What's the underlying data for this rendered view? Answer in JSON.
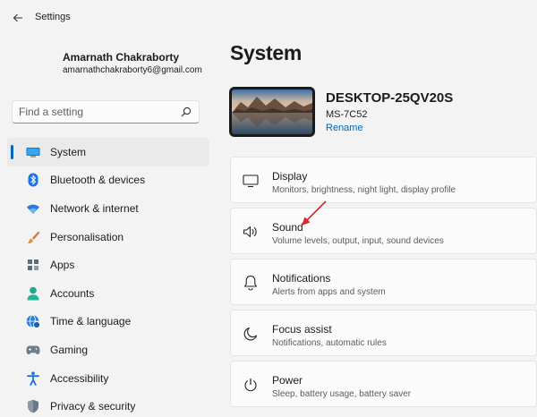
{
  "window": {
    "title": "Settings"
  },
  "profile": {
    "name": "Amarnath Chakraborty",
    "email": "amarnathchakraborty6@gmail.com"
  },
  "search": {
    "placeholder": "Find a setting"
  },
  "nav": {
    "items": [
      {
        "label": "System",
        "icon": "monitor-icon",
        "selected": true
      },
      {
        "label": "Bluetooth & devices",
        "icon": "bluetooth-icon"
      },
      {
        "label": "Network & internet",
        "icon": "wifi-icon"
      },
      {
        "label": "Personalisation",
        "icon": "brush-icon"
      },
      {
        "label": "Apps",
        "icon": "apps-icon"
      },
      {
        "label": "Accounts",
        "icon": "person-icon"
      },
      {
        "label": "Time & language",
        "icon": "globe-clock-icon"
      },
      {
        "label": "Gaming",
        "icon": "gamepad-icon"
      },
      {
        "label": "Accessibility",
        "icon": "accessibility-icon"
      },
      {
        "label": "Privacy & security",
        "icon": "shield-icon"
      }
    ]
  },
  "main": {
    "title": "System",
    "device": {
      "name": "DESKTOP-25QV20S",
      "model": "MS-7C52",
      "rename_label": "Rename"
    },
    "cards": [
      {
        "title": "Display",
        "subtitle": "Monitors, brightness, night light, display profile",
        "icon": "display-icon"
      },
      {
        "title": "Sound",
        "subtitle": "Volume levels, output, input, sound devices",
        "icon": "speaker-icon"
      },
      {
        "title": "Notifications",
        "subtitle": "Alerts from apps and system",
        "icon": "bell-icon"
      },
      {
        "title": "Focus assist",
        "subtitle": "Notifications, automatic rules",
        "icon": "moon-icon"
      },
      {
        "title": "Power",
        "subtitle": "Sleep, battery usage, battery saver",
        "icon": "power-icon"
      }
    ]
  },
  "colors": {
    "accent": "#0067c0",
    "annotation_arrow": "#d9262b"
  }
}
